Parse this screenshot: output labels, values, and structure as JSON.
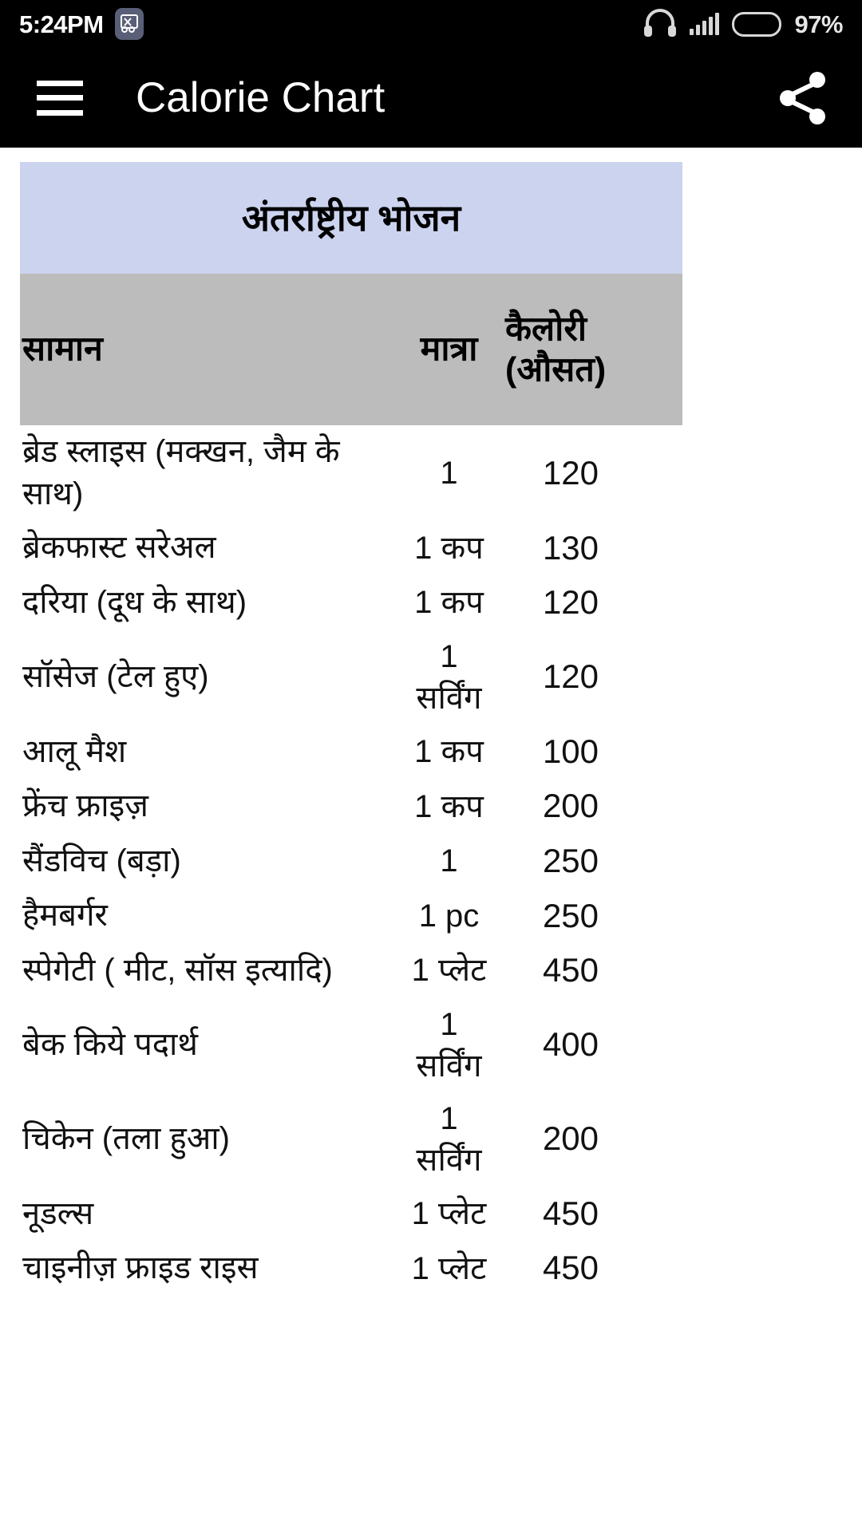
{
  "status_bar": {
    "time": "5:24PM",
    "screenshot_icon": "scissors-screenshot-icon",
    "headphone_icon": "headphone-icon",
    "signal_icon": "signal-bars-icon",
    "battery_icon": "battery-icon",
    "battery_percent": "97%"
  },
  "app_bar": {
    "menu_icon": "hamburger-menu-icon",
    "title": "Calorie Chart",
    "share_icon": "share-icon"
  },
  "table": {
    "section_title": "अंतर्राष्ट्रीय भोजन",
    "headers": {
      "item": "सामान",
      "quantity": "मात्रा",
      "calorie_line1": "कैलोरी",
      "calorie_line2": "(औसत)"
    },
    "rows": [
      {
        "item": "ब्रेड स्लाइस (मक्खन, जैम के साथ)",
        "qty": "1",
        "qty2": "",
        "cal": "120"
      },
      {
        "item": "ब्रेकफास्ट सरेअल",
        "qty": "1 कप",
        "qty2": "",
        "cal": "130"
      },
      {
        "item": "दरिया (दूध के साथ)",
        "qty": "1 कप",
        "qty2": "",
        "cal": "120"
      },
      {
        "item": "सॉसेज (टेल हुए)",
        "qty": "1",
        "qty2": "सर्विंग",
        "cal": "120"
      },
      {
        "item": "आलू मैश",
        "qty": "1 कप",
        "qty2": "",
        "cal": "100"
      },
      {
        "item": "फ्रेंच फ्राइज़",
        "qty": "1 कप",
        "qty2": "",
        "cal": "200"
      },
      {
        "item": "सैंडविच (बड़ा)",
        "qty": "1",
        "qty2": "",
        "cal": "250"
      },
      {
        "item": "हैमबर्गर",
        "qty": "1 pc",
        "qty2": "",
        "cal": "250"
      },
      {
        "item": "स्पेगेटी ( मीट, सॉस इत्यादि)",
        "qty": "1 प्लेट",
        "qty2": "",
        "cal": "450"
      },
      {
        "item": "बेक किये पदार्थ",
        "qty": "1",
        "qty2": "सर्विंग",
        "cal": "400"
      },
      {
        "item": "चिकेन (तला हुआ)",
        "qty": "1",
        "qty2": "सर्विंग",
        "cal": "200"
      },
      {
        "item": "नूडल्स",
        "qty": "1 प्लेट",
        "qty2": "",
        "cal": "450"
      },
      {
        "item": "चाइनीज़ फ्राइड राइस",
        "qty": "1 प्लेट",
        "qty2": "",
        "cal": "450"
      }
    ]
  },
  "colors": {
    "app_bar": "#000000",
    "section_band": "#ccd3ef",
    "header_band": "#bcbcbc",
    "page": "#ffffff"
  }
}
